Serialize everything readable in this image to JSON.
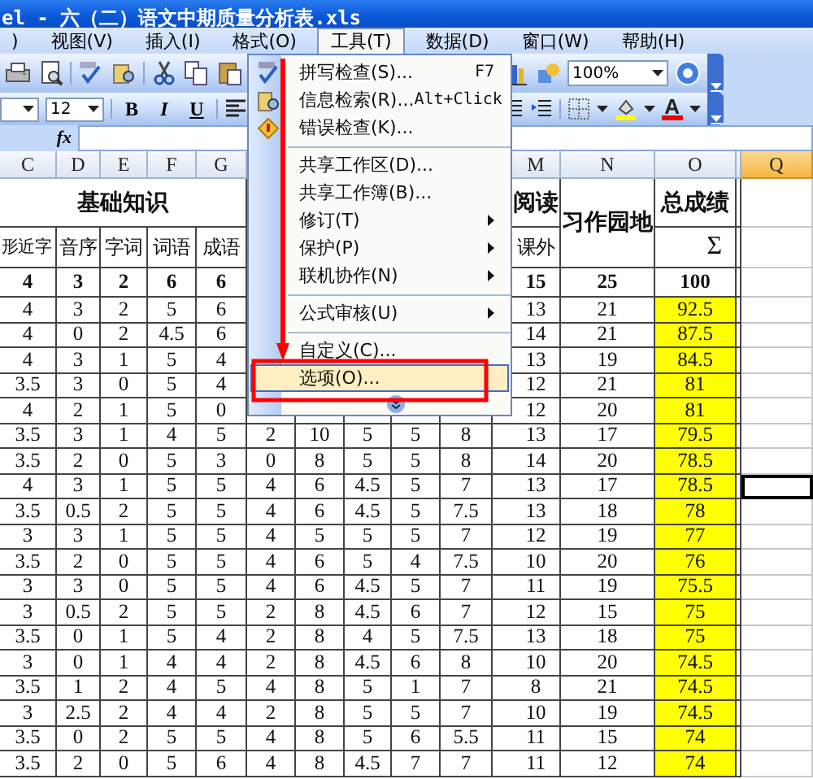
{
  "title_bar": {
    "title": "el - 六（二）语文中期质量分析表.xls"
  },
  "menu_bar": [
    {
      "label": ")",
      "selected": false
    },
    {
      "label": "视图(V)",
      "selected": false
    },
    {
      "label": "插入(I)",
      "selected": false
    },
    {
      "label": "格式(O)",
      "selected": false
    },
    {
      "label": "工具(T)",
      "selected": true
    },
    {
      "label": "数据(D)",
      "selected": false
    },
    {
      "label": "窗口(W)",
      "selected": false
    },
    {
      "label": "帮助(H)",
      "selected": false
    }
  ],
  "standard_toolbar": {
    "zoom": "100%"
  },
  "formatting_toolbar": {
    "font_size": "12",
    "bold": "B",
    "italic": "I",
    "underline": "U",
    "font_color": "A"
  },
  "formula_bar": {
    "function_label": "fx"
  },
  "column_headers": [
    {
      "label": "C",
      "selected": false
    },
    {
      "label": "D",
      "selected": false
    },
    {
      "label": "E",
      "selected": false
    },
    {
      "label": "F",
      "selected": false
    },
    {
      "label": "G",
      "selected": false
    },
    {
      "label": "M",
      "selected": false
    },
    {
      "label": "N",
      "selected": false
    },
    {
      "label": "O",
      "selected": false
    },
    {
      "label": "Q",
      "selected": true
    }
  ],
  "sheet": {
    "basic_title": "基础知识",
    "reading_title": "阅读",
    "writing_title": "习作园地",
    "total_title": "总成绩",
    "basic_subheaders": [
      "形近字",
      "音序",
      "字词",
      "词语",
      "成语"
    ],
    "reading_subheader": "课外",
    "total_symbol": "Σ",
    "max_scores": {
      "basic": [
        "4",
        "3",
        "2",
        "6",
        "6"
      ],
      "reading": "15",
      "writing": "25",
      "total": "100"
    },
    "rows": [
      {
        "basic": [
          "4",
          "3",
          "2",
          "5",
          "6"
        ],
        "reading": "13",
        "writing": "21",
        "total": "92.5",
        "q_selected": false
      },
      {
        "basic": [
          "4",
          "0",
          "2",
          "4.5",
          "6"
        ],
        "reading": "14",
        "writing": "21",
        "total": "87.5",
        "q_selected": false
      },
      {
        "basic": [
          "4",
          "3",
          "1",
          "5",
          "4"
        ],
        "reading": "13",
        "writing": "19",
        "total": "84.5",
        "q_selected": false
      },
      {
        "basic": [
          "3.5",
          "3",
          "0",
          "5",
          "4"
        ],
        "reading": "12",
        "writing": "21",
        "total": "81",
        "q_selected": false
      },
      {
        "basic": [
          "4",
          "2",
          "1",
          "5",
          "0"
        ],
        "reading": "12",
        "writing": "20",
        "total": "81",
        "q_selected": false
      },
      {
        "basic": [
          "3.5",
          "3",
          "1",
          "4",
          "5"
        ],
        "middle": [
          "2",
          "10",
          "5",
          "5",
          "8"
        ],
        "reading": "13",
        "writing": "17",
        "total": "79.5",
        "q_selected": false
      },
      {
        "basic": [
          "3.5",
          "2",
          "0",
          "5",
          "3"
        ],
        "middle": [
          "0",
          "8",
          "5",
          "5",
          "8"
        ],
        "reading": "14",
        "writing": "20",
        "total": "78.5",
        "q_selected": false
      },
      {
        "basic": [
          "4",
          "3",
          "1",
          "5",
          "5"
        ],
        "middle": [
          "4",
          "6",
          "4.5",
          "5",
          "7"
        ],
        "reading": "13",
        "writing": "17",
        "total": "78.5",
        "q_selected": true
      },
      {
        "basic": [
          "3.5",
          "0.5",
          "2",
          "5",
          "5"
        ],
        "middle": [
          "4",
          "6",
          "4.5",
          "5",
          "7.5"
        ],
        "reading": "13",
        "writing": "18",
        "total": "78",
        "q_selected": false
      },
      {
        "basic": [
          "3",
          "3",
          "1",
          "5",
          "5"
        ],
        "middle": [
          "4",
          "5",
          "5",
          "5",
          "7"
        ],
        "reading": "12",
        "writing": "19",
        "total": "77",
        "q_selected": false
      },
      {
        "basic": [
          "3.5",
          "2",
          "0",
          "5",
          "5"
        ],
        "middle": [
          "4",
          "6",
          "5",
          "4",
          "7.5"
        ],
        "reading": "10",
        "writing": "20",
        "total": "76",
        "q_selected": false
      },
      {
        "basic": [
          "3",
          "3",
          "0",
          "5",
          "5"
        ],
        "middle": [
          "4",
          "6",
          "4.5",
          "5",
          "7"
        ],
        "reading": "11",
        "writing": "19",
        "total": "75.5",
        "q_selected": false
      },
      {
        "basic": [
          "3",
          "0.5",
          "2",
          "5",
          "5"
        ],
        "middle": [
          "2",
          "8",
          "4.5",
          "6",
          "7"
        ],
        "reading": "12",
        "writing": "15",
        "total": "75",
        "q_selected": false
      },
      {
        "basic": [
          "3.5",
          "0",
          "1",
          "5",
          "4"
        ],
        "middle": [
          "2",
          "8",
          "4",
          "5",
          "7.5"
        ],
        "reading": "13",
        "writing": "18",
        "total": "75",
        "q_selected": false
      },
      {
        "basic": [
          "3",
          "0",
          "1",
          "4",
          "4"
        ],
        "middle": [
          "2",
          "8",
          "4.5",
          "6",
          "8"
        ],
        "reading": "10",
        "writing": "20",
        "total": "74.5",
        "q_selected": false
      },
      {
        "basic": [
          "3.5",
          "1",
          "2",
          "4",
          "5"
        ],
        "middle": [
          "4",
          "8",
          "5",
          "1",
          "7"
        ],
        "reading": "8",
        "writing": "21",
        "total": "74.5",
        "q_selected": false
      },
      {
        "basic": [
          "3",
          "2.5",
          "2",
          "4",
          "4"
        ],
        "middle": [
          "2",
          "8",
          "5",
          "5",
          "7"
        ],
        "reading": "10",
        "writing": "19",
        "total": "74.5",
        "q_selected": false
      },
      {
        "basic": [
          "3.5",
          "0",
          "2",
          "5",
          "5"
        ],
        "middle": [
          "4",
          "8",
          "5",
          "6",
          "5.5"
        ],
        "reading": "11",
        "writing": "15",
        "total": "74",
        "q_selected": false
      },
      {
        "basic": [
          "3.5",
          "2",
          "0",
          "5",
          "6"
        ],
        "middle": [
          "4",
          "8",
          "4.5",
          "7",
          "7"
        ],
        "reading": "11",
        "writing": "12",
        "total": "74",
        "q_selected": false
      }
    ]
  },
  "tools_menu": {
    "items": [
      {
        "kind": "command",
        "label": "拼写检查(S)...",
        "shortcut": "F7",
        "icon": true,
        "selected": false
      },
      {
        "kind": "command",
        "label": "信息检索(R)...",
        "shortcut": "Alt+Click",
        "icon": true,
        "selected": false
      },
      {
        "kind": "command",
        "label": "错误检查(K)...",
        "icon": true,
        "selected": false
      },
      {
        "kind": "separator"
      },
      {
        "kind": "command",
        "label": "共享工作区(D)...",
        "icon": false,
        "selected": false
      },
      {
        "kind": "command",
        "label": "共享工作簿(B)...",
        "icon": false,
        "selected": false
      },
      {
        "kind": "submenu",
        "label": "修订(T)",
        "icon": false,
        "selected": false
      },
      {
        "kind": "submenu",
        "label": "保护(P)",
        "icon": false,
        "selected": false
      },
      {
        "kind": "submenu",
        "label": "联机协作(N)",
        "icon": false,
        "selected": false
      },
      {
        "kind": "separator"
      },
      {
        "kind": "submenu",
        "label": "公式审核(U)",
        "icon": false,
        "selected": false
      },
      {
        "kind": "separator"
      },
      {
        "kind": "command",
        "label": "自定义(C)...",
        "icon": false,
        "selected": false
      },
      {
        "kind": "command",
        "label": "选项(O)...",
        "icon": false,
        "selected": true
      }
    ]
  },
  "annotations": [
    {
      "kind": "arrow"
    },
    {
      "kind": "box"
    }
  ]
}
